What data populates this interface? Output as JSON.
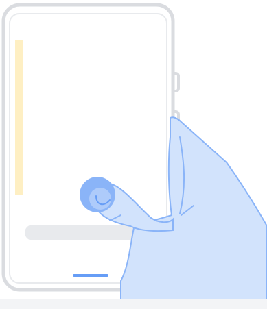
{
  "illustration": {
    "subject": "phone-tap-gesture",
    "icons": {
      "device": "phone-outline-icon",
      "hand": "hand-icon",
      "touch": "touch-point-icon"
    },
    "colors": {
      "phone_frame": "#dadce0",
      "screen": "#ffffff",
      "side_bar": "#feefc3",
      "bottom_field": "#e8eaed",
      "nav_handle": "#669df6",
      "hand_fill": "#d2e3fc",
      "hand_outline": "#8ab4f8",
      "touch_ring": "#8ab4f8",
      "background": "#ffffff"
    }
  }
}
